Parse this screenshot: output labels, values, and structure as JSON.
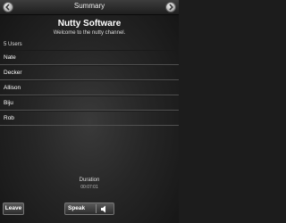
{
  "window": {
    "title": "Summary"
  },
  "channel": {
    "name": "Nutty Software",
    "welcome": "Welcome to the nutty channel."
  },
  "users": {
    "count_label": "5 Users",
    "items": [
      "Nate",
      "Decker",
      "Allison",
      "Biju",
      "Rob"
    ]
  },
  "duration": {
    "label": "Duration",
    "value": "00:07:01"
  },
  "buttons": {
    "leave": "Leave",
    "speak": "Speak"
  },
  "icons": {
    "back": "chevron-left-icon",
    "forward": "chevron-right-icon",
    "speaker": "speaker-icon"
  }
}
